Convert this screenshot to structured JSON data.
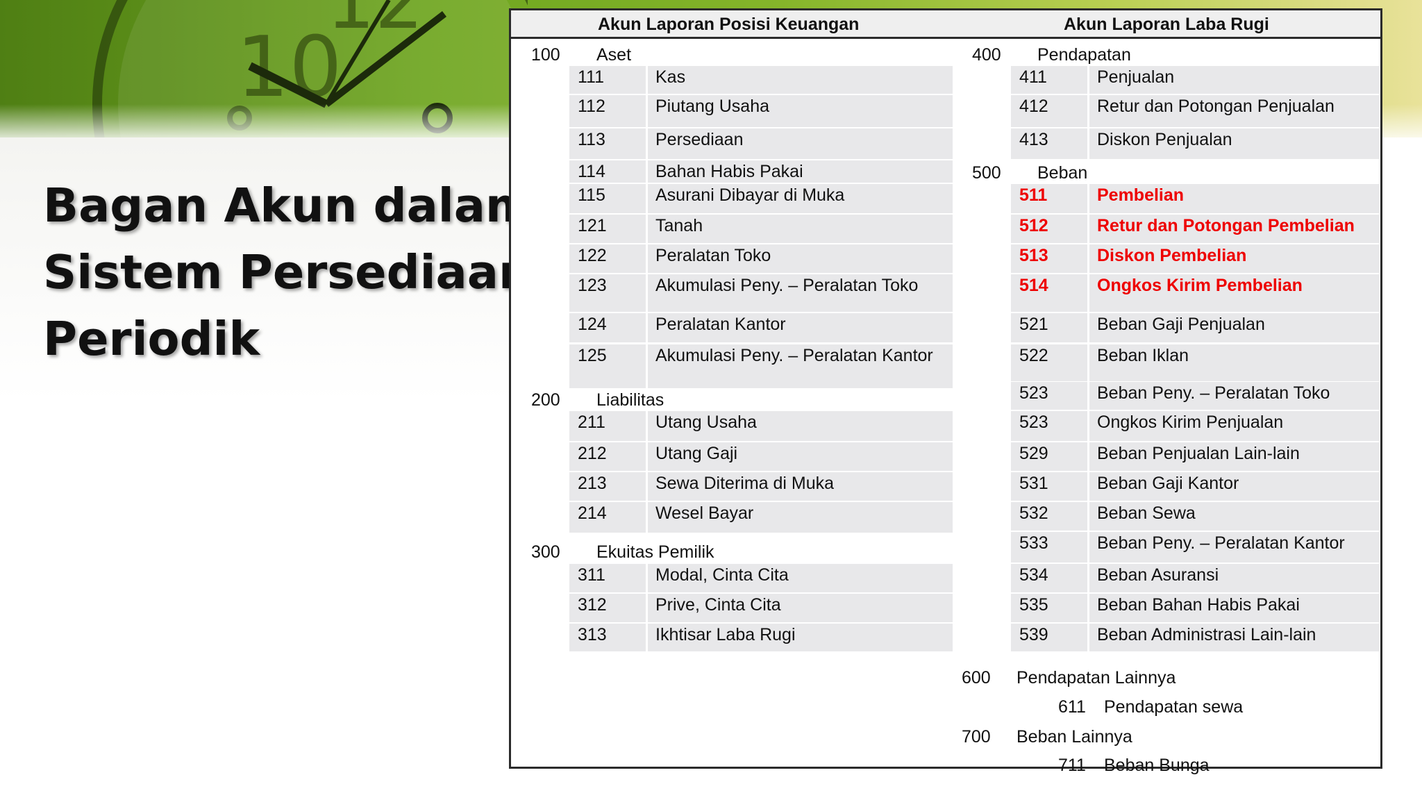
{
  "slide": {
    "title_lines": [
      "Bagan Akun dalam",
      "Sistem Persediaan",
      "Periodik"
    ]
  },
  "table": {
    "left_header": "Akun Laporan Posisi Keuangan",
    "right_header": "Akun Laporan Laba Rugi",
    "left_groups": [
      {
        "code": "100",
        "name": "Aset"
      },
      {
        "code": "200",
        "name": "Liabilitas"
      },
      {
        "code": "300",
        "name": "Ekuitas Pemilik"
      }
    ],
    "left_rows": [
      {
        "code": "111",
        "name": "Kas"
      },
      {
        "code": "112",
        "name": "Piutang Usaha"
      },
      {
        "code": "113",
        "name": "Persediaan"
      },
      {
        "code": "114",
        "name": "Bahan Habis Pakai"
      },
      {
        "code": "115",
        "name": "Asurani Dibayar di Muka"
      },
      {
        "code": "121",
        "name": "Tanah"
      },
      {
        "code": "122",
        "name": "Peralatan Toko"
      },
      {
        "code": "123",
        "name": "Akumulasi Peny. – Peralatan Toko"
      },
      {
        "code": "124",
        "name": "Peralatan Kantor"
      },
      {
        "code": "125",
        "name": "Akumulasi Peny. – Peralatan Kantor"
      },
      {
        "code": "211",
        "name": "Utang Usaha"
      },
      {
        "code": "212",
        "name": "Utang Gaji"
      },
      {
        "code": "213",
        "name": "Sewa Diterima di Muka"
      },
      {
        "code": "214",
        "name": "Wesel Bayar"
      },
      {
        "code": "311",
        "name": "Modal, Cinta Cita"
      },
      {
        "code": "312",
        "name": "Prive, Cinta Cita"
      },
      {
        "code": "313",
        "name": "Ikhtisar Laba Rugi"
      }
    ],
    "right_groups": [
      {
        "code": "400",
        "name": "Pendapatan"
      },
      {
        "code": "500",
        "name": "Beban"
      },
      {
        "code": "600",
        "name": "Pendapatan Lainnya"
      },
      {
        "code": "700",
        "name": "Beban Lainnya"
      }
    ],
    "right_rows": [
      {
        "code": "411",
        "name": "Penjualan"
      },
      {
        "code": "412",
        "name": "Retur dan Potongan Penjualan"
      },
      {
        "code": "413",
        "name": "Diskon Penjualan"
      },
      {
        "code": "511",
        "name": "Pembelian",
        "highlight": true
      },
      {
        "code": "512",
        "name": "Retur dan Potongan Pembelian",
        "highlight": true
      },
      {
        "code": "513",
        "name": "Diskon Pembelian",
        "highlight": true
      },
      {
        "code": "514",
        "name": "Ongkos Kirim Pembelian",
        "highlight": true
      },
      {
        "code": "521",
        "name": "Beban Gaji Penjualan"
      },
      {
        "code": "522",
        "name": "Beban Iklan"
      },
      {
        "code": "523",
        "name": "Beban Peny. – Peralatan Toko"
      },
      {
        "code": "523",
        "name": "Ongkos Kirim Penjualan"
      },
      {
        "code": "529",
        "name": "Beban Penjualan Lain-lain"
      },
      {
        "code": "531",
        "name": "Beban Gaji Kantor"
      },
      {
        "code": "532",
        "name": "Beban Sewa"
      },
      {
        "code": "533",
        "name": "Beban Peny. – Peralatan Kantor"
      },
      {
        "code": "534",
        "name": "Beban Asuransi"
      },
      {
        "code": "535",
        "name": "Beban Bahan Habis Pakai"
      },
      {
        "code": "539",
        "name": "Beban Administrasi Lain-lain"
      }
    ],
    "right_plain_rows": [
      {
        "code": "611",
        "name": "Pendapatan sewa"
      },
      {
        "code": "711",
        "name": "Beban Bunga"
      }
    ],
    "highlight_color": "#ee0000"
  }
}
